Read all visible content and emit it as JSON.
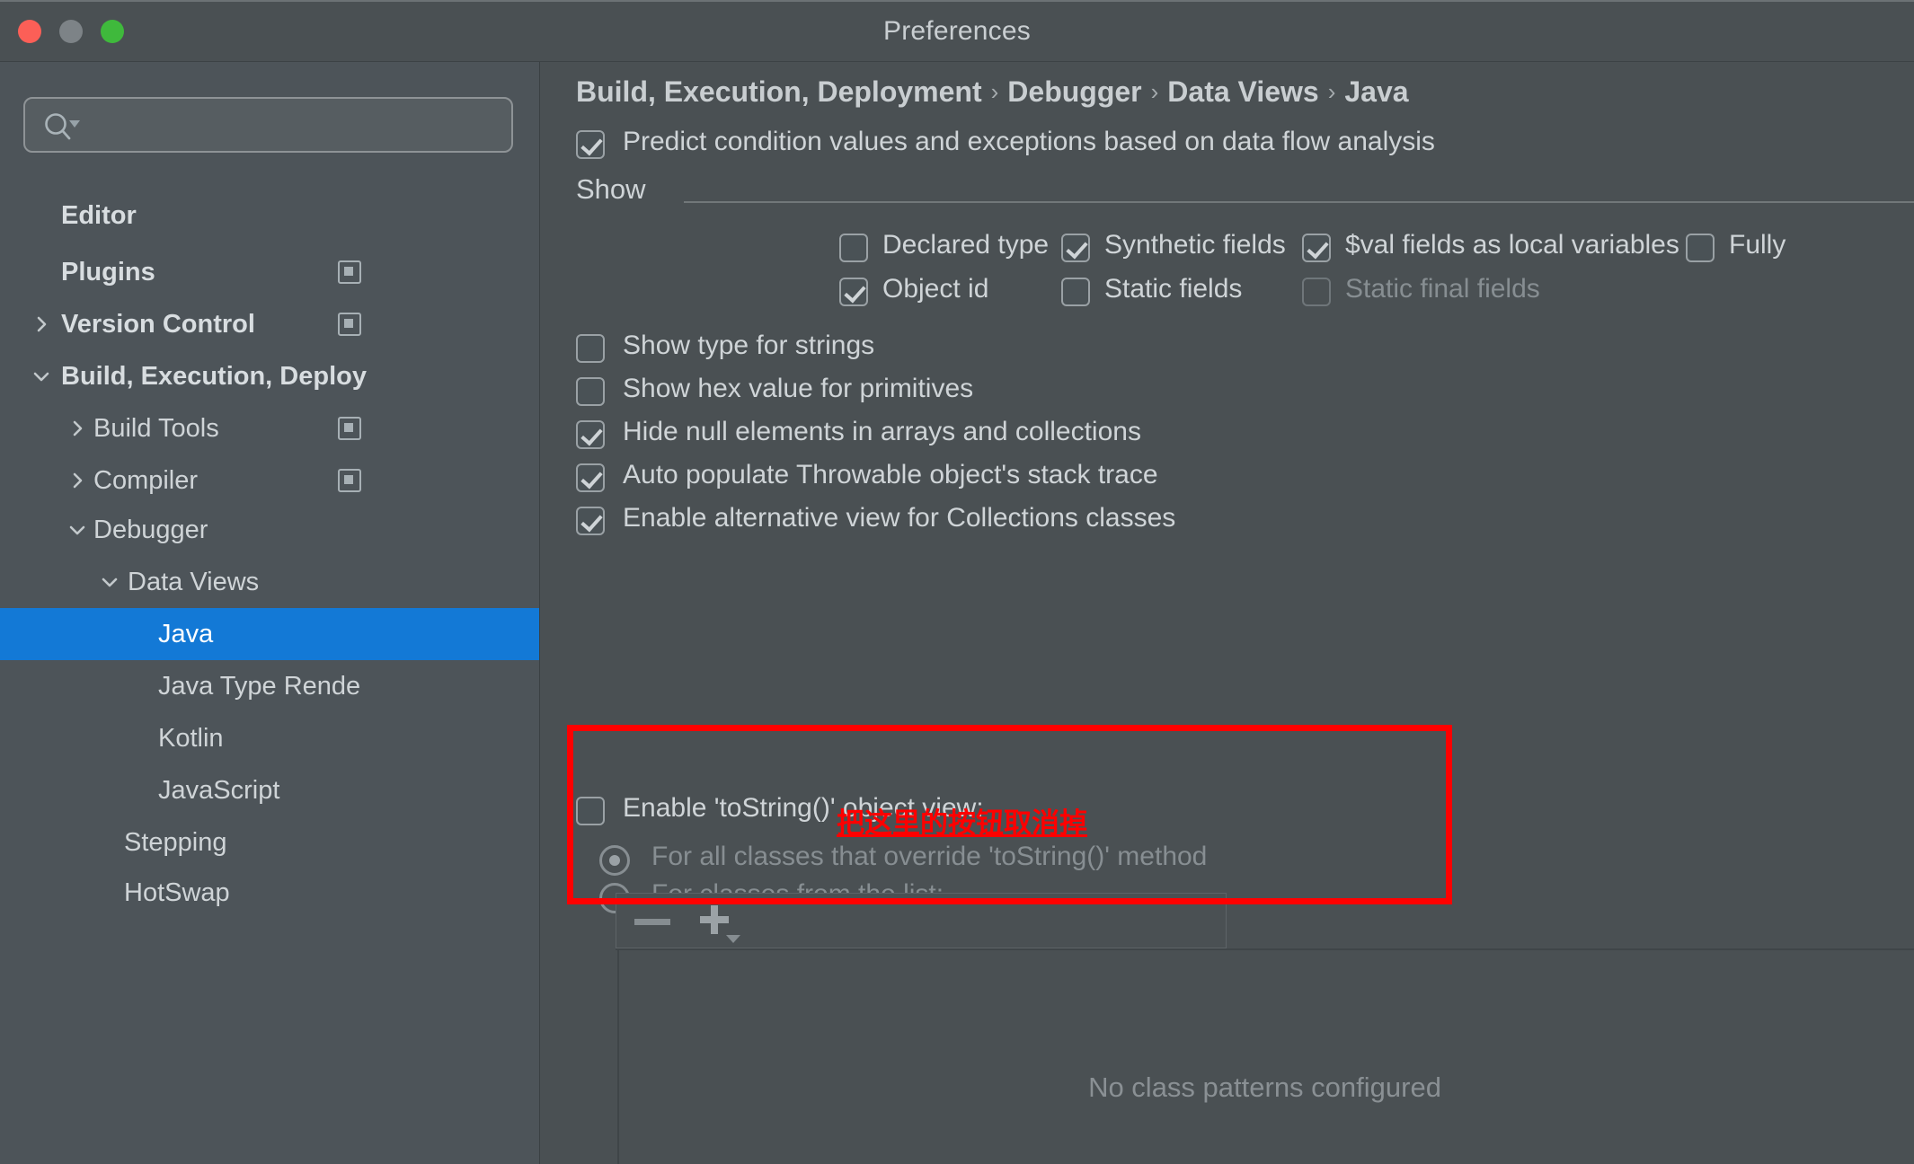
{
  "window": {
    "title": "Preferences",
    "traffic_lights": [
      "close-button",
      "minimize-button",
      "maximize-button"
    ]
  },
  "sidebar": {
    "search": {
      "value": "",
      "placeholder": "",
      "icon": "search-icon"
    },
    "items": [
      {
        "label": "Editor",
        "level": 0,
        "bold": true,
        "arrow": "none",
        "badge": false,
        "selected": false
      },
      {
        "label": "Plugins",
        "level": 0,
        "bold": true,
        "arrow": "none",
        "badge": true,
        "selected": false
      },
      {
        "label": "Version Control",
        "level": 0,
        "bold": true,
        "arrow": "right",
        "badge": true,
        "selected": false
      },
      {
        "label": "Build, Execution, Deploy",
        "level": 0,
        "bold": true,
        "arrow": "down",
        "badge": false,
        "selected": false
      },
      {
        "label": "Build Tools",
        "level": 1,
        "bold": false,
        "arrow": "right",
        "badge": true,
        "selected": false
      },
      {
        "label": "Compiler",
        "level": 1,
        "bold": false,
        "arrow": "right",
        "badge": true,
        "selected": false
      },
      {
        "label": "Debugger",
        "level": 1,
        "bold": false,
        "arrow": "down",
        "badge": false,
        "selected": false
      },
      {
        "label": "Data Views",
        "level": 2,
        "bold": false,
        "arrow": "down",
        "badge": false,
        "selected": false
      },
      {
        "label": "Java",
        "level": 3,
        "bold": false,
        "arrow": "none",
        "badge": false,
        "selected": true
      },
      {
        "label": "Java Type Rende",
        "level": 3,
        "bold": false,
        "arrow": "none",
        "badge": false,
        "selected": false
      },
      {
        "label": "Kotlin",
        "level": 3,
        "bold": false,
        "arrow": "none",
        "badge": false,
        "selected": false
      },
      {
        "label": "JavaScript",
        "level": 3,
        "bold": false,
        "arrow": "none",
        "badge": false,
        "selected": false
      },
      {
        "label": "Stepping",
        "level": 2,
        "bold": false,
        "arrow": "none",
        "badge": false,
        "selected": false
      },
      {
        "label": "HotSwap",
        "level": 2,
        "bold": false,
        "arrow": "none",
        "badge": false,
        "selected": false
      }
    ],
    "scrollbar": "vertical-scrollbar"
  },
  "main": {
    "breadcrumb": [
      "Build, Execution, Deployment",
      "Debugger",
      "Data Views",
      "Java"
    ],
    "breadcrumb_separator": "›",
    "predict_option": {
      "label": "Predict condition values and exceptions based on data flow analysis",
      "checked": true
    },
    "show_group": {
      "title": "Show",
      "row1": [
        {
          "label": "Declared type",
          "checked": false,
          "disabled": false
        },
        {
          "label": "Synthetic fields",
          "checked": true,
          "disabled": false
        },
        {
          "label": "$val fields as local variables",
          "checked": true,
          "disabled": false
        },
        {
          "label": "Fully",
          "checked": false,
          "disabled": false
        }
      ],
      "row2": [
        {
          "label": "Object id",
          "checked": true,
          "disabled": false
        },
        {
          "label": "Static fields",
          "checked": false,
          "disabled": false
        },
        {
          "label": "Static final fields",
          "checked": false,
          "disabled": true
        }
      ]
    },
    "options": [
      {
        "label": "Show type for strings",
        "checked": false
      },
      {
        "label": "Show hex value for primitives",
        "checked": false
      },
      {
        "label": "Hide null elements in arrays and collections",
        "checked": true
      },
      {
        "label": "Auto populate Throwable object's stack trace",
        "checked": true
      },
      {
        "label": "Enable alternative view for Collections classes",
        "checked": true
      }
    ],
    "tostring_section": {
      "checkbox_label": "Enable 'toString()' object view:",
      "checked": false,
      "annotation": "把这里的按钮取消掉",
      "annotation_color": "#ff0000",
      "radios": [
        {
          "label": "For all classes that override 'toString()' method",
          "selected": true
        },
        {
          "label": "For classes from the list:",
          "selected": false
        }
      ],
      "toolbar": {
        "remove_icon": "minus-icon",
        "add_icon": "plus-icon",
        "add_dropdown_icon": "chevron-down-icon"
      },
      "empty_message": "No class patterns configured"
    }
  },
  "colors": {
    "window_bg": "#4a5053",
    "sidebar_bg": "#4d5459",
    "selection": "#1379d6",
    "text": "#cfd4d7",
    "text_dim": "#878e92",
    "annotation": "#ff0000"
  }
}
